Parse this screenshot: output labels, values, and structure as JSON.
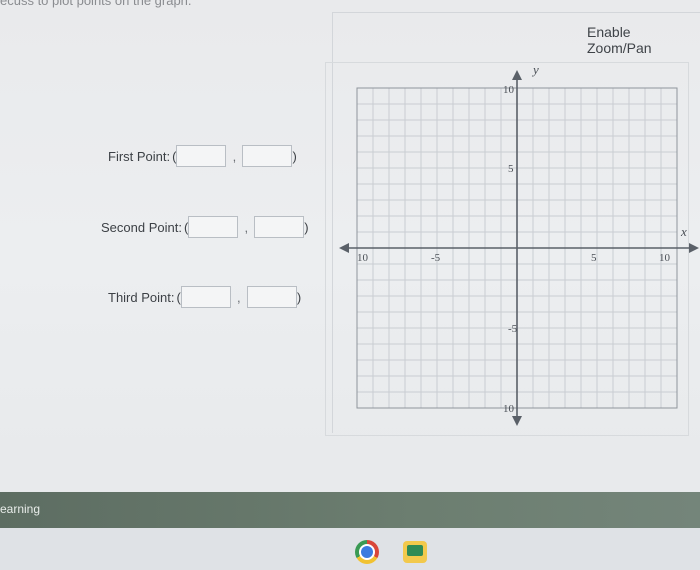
{
  "header": {
    "caption": "ecuss to plot points on the graph."
  },
  "toolbar": {
    "zoom_label": "Enable Zoom/Pan"
  },
  "points": [
    {
      "label": "First Point:",
      "open": "(",
      "comma": ",",
      "close": ")",
      "x_value": "",
      "y_value": ""
    },
    {
      "label": "Second Point:",
      "open": "(",
      "comma": ",",
      "close": ")",
      "x_value": "",
      "y_value": ""
    },
    {
      "label": "Third Point:",
      "open": "(",
      "comma": ",",
      "close": ")",
      "x_value": "",
      "y_value": ""
    }
  ],
  "graph": {
    "x_axis_label": "x",
    "y_axis_label": "y",
    "xlim": [
      -10,
      10
    ],
    "ylim": [
      -10,
      10
    ],
    "x_ticks": [
      "10",
      "-5",
      "5",
      "10"
    ],
    "y_ticks": [
      "10",
      "5",
      "-5",
      "10"
    ],
    "grid": true,
    "grid_step": 1,
    "colors": {
      "grid": "#c9cdd2",
      "axis": "#5a6068",
      "border": "#8f959c"
    }
  },
  "footer": {
    "text": "earning"
  },
  "taskbar": {
    "icons": [
      "chrome-icon",
      "classroom-icon"
    ]
  }
}
